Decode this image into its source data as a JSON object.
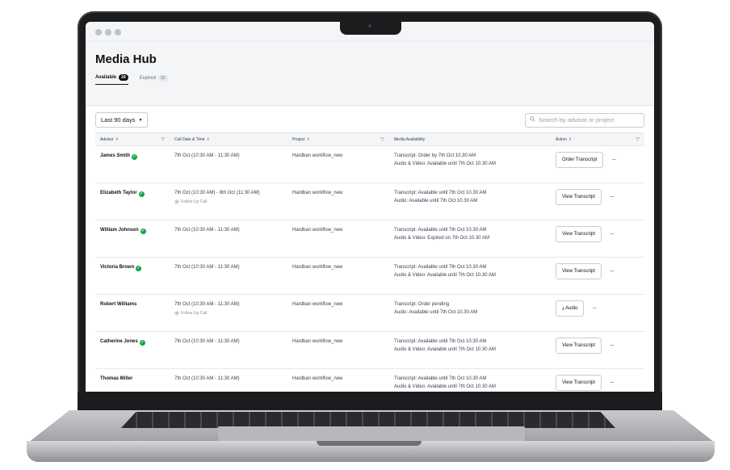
{
  "app": {
    "title": "Media Hub",
    "tabs": [
      {
        "label": "Available",
        "count": "24"
      },
      {
        "label": "Expired",
        "count": "22"
      }
    ]
  },
  "toolbar": {
    "date_filter": "Last 90 days",
    "search_placeholder": "Search by advisor or project"
  },
  "table": {
    "headers": {
      "advisor": "Advisor",
      "call_date": "Call Date & Time",
      "project": "Project",
      "media": "Media Availability",
      "action": "Action"
    },
    "rows": [
      {
        "advisor": "James Smith",
        "verified": true,
        "date": "7th Oct (10:30 AM - 11:30 AM)",
        "follow_up": "",
        "project": "Hardban workflow_new",
        "media1": "Transcript: Order by 7th Oct 10.30 AM",
        "media2": "Audio & Video: Available until 7th Oct 10.30 AM",
        "action": "Order Transcript"
      },
      {
        "advisor": "Elizabeth Taylor",
        "verified": true,
        "date": "7th Oct (10:30 AM) - 8th Oct (11:30 AM)",
        "follow_up": "Follow Up Call",
        "project": "Hardban workflow_new",
        "media1": "Transcript: Available until 7th Oct 10.30 AM",
        "media2": "Audio: Available until 7th Oct 10.30 AM",
        "action": "View Transcript"
      },
      {
        "advisor": "William Johnson",
        "verified": true,
        "date": "7th Oct (10:30 AM - 11:30 AM)",
        "follow_up": "",
        "project": "Hardban workflow_new",
        "media1": "Transcript: Available until 7th Oct 10.30 AM",
        "media2": "Audio & Video: Expired on 7th Oct 10.30 AM",
        "action": "View Transcript"
      },
      {
        "advisor": "Victoria Brown",
        "verified": true,
        "date": "7th Oct (10:30 AM - 11:30 AM)",
        "follow_up": "",
        "project": "Hardban workflow_new",
        "media1": "Transcript: Available until 7th Oct 10.30 AM",
        "media2": "Audio & Video: Available until 7th Oct 10.30 AM",
        "action": "View Transcript"
      },
      {
        "advisor": "Robert Williams",
        "verified": false,
        "date": "7th Oct (10:30 AM - 11:30 AM)",
        "follow_up": "Follow Up Call",
        "project": "Hardban workflow_new",
        "media1": "Transcript: Order pending",
        "media2": "Audio: Available until 7th Oct 10.30 AM",
        "action": "Audio"
      },
      {
        "advisor": "Catherine Jones",
        "verified": true,
        "date": "7th Oct (10:30 AM - 11:30 AM)",
        "follow_up": "",
        "project": "Hardban workflow_new",
        "media1": "Transcript: Available until 7th Oct 10.30 AM",
        "media2": "Audio & Video: Available until 7th Oct 10.30 AM",
        "action": "View Transcript"
      },
      {
        "advisor": "Thomas Miller",
        "verified": false,
        "date": "7th Oct (10:30 AM - 11:30 AM)",
        "follow_up": "",
        "project": "Hardban workflow_new",
        "media1": "Transcript: Available until 7th Oct 10.30 AM",
        "media2": "Audio & Video: Available until 7th Oct 10.30 AM",
        "action": "View Transcript"
      }
    ]
  },
  "icons": {
    "verified": "check-badge-icon",
    "download": "download-icon",
    "more": "more-icon",
    "filter": "filter-icon",
    "search": "search-icon"
  },
  "colors": {
    "verified": "#16a34a",
    "header_bg": "#f3f5f7",
    "laptop_frame": "#1b1c1e"
  }
}
